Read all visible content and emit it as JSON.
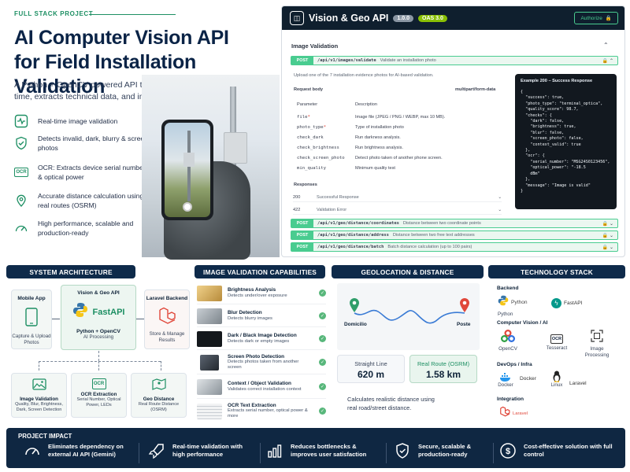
{
  "hero": {
    "kicker": "FULL STACK PROJECT",
    "title_line1": "AI Computer Vision API",
    "title_line2": "for Field Installation Validation",
    "lead": "A Python + OpenCV powered API that validates field photos in real time, extracts technical data, and improves operational efficiency.",
    "features": [
      {
        "icon": "pulse-icon",
        "text": "Real-time image validation"
      },
      {
        "icon": "shield-check-icon",
        "text": "Detects invalid, dark, blurry & screen photos"
      },
      {
        "icon": "ocr-icon",
        "icon_text": "OCR",
        "text": "OCR: Extracts device serial number & optical power"
      },
      {
        "icon": "location-pin-icon",
        "text": "Accurate distance calculation using real routes (OSRM)"
      },
      {
        "icon": "speedometer-icon",
        "text": "High performance, scalable and production-ready"
      }
    ]
  },
  "api": {
    "title": "Vision & Geo API",
    "version_badge": "1.0.0",
    "oas_badge": "OAS 3.0",
    "authorize_label": "Authorize",
    "section_title": "Image Validation",
    "main_op": {
      "method": "POST",
      "path": "/api/v1/images/validate",
      "summary": "Validate an installation photo"
    },
    "op_description": "Upload one of the 7 installation evidence photos for AI-based validation.",
    "request_body_label": "Request body",
    "content_type": "multipart/form-data",
    "param_header": [
      "Parameter",
      "Description"
    ],
    "params": [
      {
        "name": "file",
        "required": true,
        "desc": "Image file (JPEG / PNG / WEBP, max 10 MB)."
      },
      {
        "name": "photo_type",
        "required": true,
        "desc": "Type of installation photo"
      },
      {
        "name": "check_dark",
        "required": false,
        "desc": "Run darkness analysis."
      },
      {
        "name": "check_brightness",
        "required": false,
        "desc": "Run brightness analysis."
      },
      {
        "name": "check_screen_photo",
        "required": false,
        "desc": "Detect photo taken of another phone screen."
      },
      {
        "name": "min_quality",
        "required": false,
        "desc": "Minimum quality test"
      }
    ],
    "responses_label": "Responses",
    "responses": [
      {
        "code": "200",
        "desc": "Successful Response"
      },
      {
        "code": "422",
        "desc": "Validation Error"
      }
    ],
    "example": {
      "title": "Example 200 – Success Response",
      "lines": [
        "{",
        "  \"success\": true,",
        "  \"photo_type\": \"terminal_optica\",",
        "  \"quality_score\": 98.7,",
        "  \"checks\": {",
        "    \"dark\": false,",
        "    \"brightness\": true,",
        "    \"blur\": false,",
        "    \"screen_photo\": false,",
        "    \"context_valid\": true",
        "  },",
        "  \"ocr\": {",
        "    \"serial_number\": \"MSG24S0123456\",",
        "    \"optical_power\": \"-18.5",
        "    dBm\"",
        "  },",
        "  \"message\": \"Image is valid\"",
        "}"
      ]
    },
    "other_ops": [
      {
        "method": "POST",
        "path": "/api/v1/geo/distance/coordinates",
        "summary": "Distance between two coordinate points"
      },
      {
        "method": "POST",
        "path": "/api/v1/geo/distance/address",
        "summary": "Distance between two free text addresses"
      },
      {
        "method": "POST",
        "path": "/api/v1/geo/distance/batch",
        "summary": "Batch distance calculation (up to 100 pairs)"
      }
    ]
  },
  "arch": {
    "header": "SYSTEM ARCHITECTURE",
    "mobile_title": "Mobile App",
    "mobile_desc": "Capture & Upload Photos",
    "core_title": "Vision & Geo API",
    "core_brand": "FastAPI",
    "core_stack": "Python + OpenCV",
    "core_desc": "AI Processing",
    "laravel_title": "Laravel Backend",
    "laravel_desc": "Store & Manage Results",
    "modules": [
      {
        "icon": "image-icon",
        "title": "Image Validation",
        "desc": "Quality, Blur, Brightness, Dark, Screen Detection"
      },
      {
        "icon": "ocr-icon",
        "icon_text": "OCR",
        "title": "OCR Extraction",
        "desc": "Serial Number, Optical Power, LEDs"
      },
      {
        "icon": "map-pin-icon",
        "title": "Geo Distance",
        "desc": "Real Route Distance (OSRM)"
      }
    ]
  },
  "caps": {
    "header": "IMAGE VALIDATION CAPABILITIES",
    "items": [
      {
        "title": "Brightness Analysis",
        "desc": "Detects under/over exposure",
        "thumb": "#d9b45c"
      },
      {
        "title": "Blur Detection",
        "desc": "Detects blurry images",
        "thumb": "#9aa3aa"
      },
      {
        "title": "Dark / Black Image Detection",
        "desc": "Detects dark or empty images",
        "thumb": "#14181c"
      },
      {
        "title": "Screen Photo Detection",
        "desc": "Detects photos taken from another screen",
        "thumb": "#3a4048"
      },
      {
        "title": "Context / Object Validation",
        "desc": "Validates correct installation context",
        "thumb": "#b8bfc5"
      },
      {
        "title": "OCR Text Extraction",
        "desc": "Extracts serial number, optical power & more",
        "thumb": "#e6e8ea"
      }
    ]
  },
  "geo": {
    "header": "GEOLOCATION & DISTANCE",
    "from_label": "Domicilio",
    "to_label": "Poste",
    "straight_label": "Straight Line",
    "straight_value": "620 m",
    "route_label": "Real Route (OSRM)",
    "route_value": "1.58 km",
    "note": "Calculates realistic distance using real road/street distance."
  },
  "tech": {
    "header": "TECHNOLOGY STACK",
    "backend_label": "Backend",
    "backend": [
      {
        "name": "Python",
        "icon": "python-icon"
      },
      {
        "name": "FastAPI",
        "icon": "fastapi-icon"
      }
    ],
    "cv_label": "Computer Vision / AI",
    "cv": [
      {
        "name": "OpenCV",
        "icon": "opencv-icon"
      },
      {
        "name": "Tesseract",
        "icon": "ocr-icon",
        "icon_text": "OCR"
      },
      {
        "name": "Image Processing",
        "icon": "image-processing-icon"
      }
    ],
    "devops_label": "DevOps / Infra",
    "devops": [
      {
        "name": "Docker",
        "icon": "docker-icon"
      },
      {
        "name": "Linux",
        "icon": "linux-icon"
      }
    ],
    "devops_side": {
      "name": "Laravel",
      "icon": "laravel-icon"
    },
    "integration_label": "Integration",
    "integration": [
      {
        "name": "Laravel",
        "icon": "laravel-icon"
      }
    ]
  },
  "impact": {
    "header": "PROJECT IMPACT",
    "items": [
      {
        "icon": "gauge-icon",
        "text": "Eliminates dependency on external AI API (Gemini)"
      },
      {
        "icon": "rocket-icon",
        "text": "Real-time validation with high performance"
      },
      {
        "icon": "bar-chart-icon",
        "text": "Reduces bottlenecks & improves user satisfaction"
      },
      {
        "icon": "shield-icon",
        "text": "Secure, scalable & production-ready"
      },
      {
        "icon": "dollar-icon",
        "text": "Cost-effective solution with full control"
      }
    ]
  },
  "colors": {
    "brand": "#0e2a4a",
    "accent": "#1d8f63",
    "post": "#49cc90",
    "laravel": "#e0473a"
  }
}
